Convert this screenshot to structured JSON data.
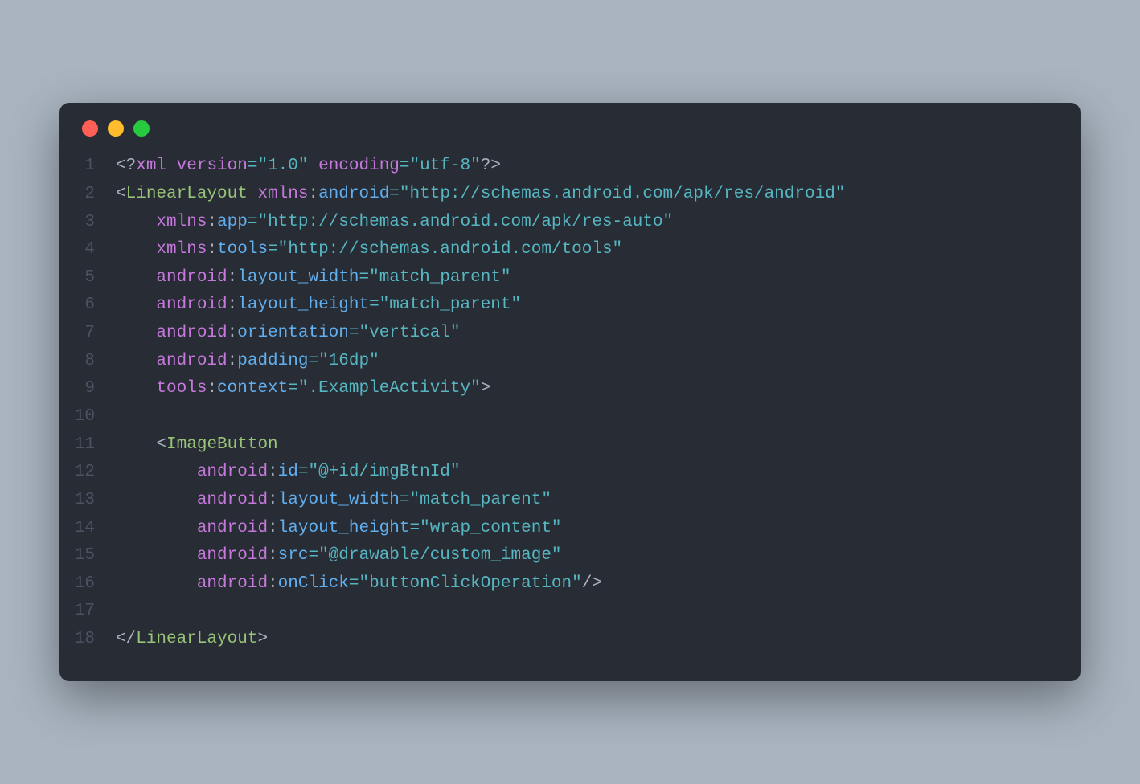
{
  "window": {
    "traffic": {
      "red": "#ff5f56",
      "yellow": "#ffbd2e",
      "green": "#27c93f"
    }
  },
  "lines": {
    "n1": "1",
    "n2": "2",
    "n3": "3",
    "n4": "4",
    "n5": "5",
    "n6": "6",
    "n7": "7",
    "n8": "8",
    "n9": "9",
    "n10": "10",
    "n11": "11",
    "n12": "12",
    "n13": "13",
    "n14": "14",
    "n15": "15",
    "n16": "16",
    "n17": "17",
    "n18": "18"
  },
  "t": {
    "lt": "<",
    "gt": ">",
    "ltq": "<?",
    "qgt": "?>",
    "slgt": "/>",
    "ltsl": "</",
    "eq": "=",
    "xml": "xml",
    "version": "version",
    "encoding": "encoding",
    "LinearLayout": "LinearLayout",
    "ImageButton": "ImageButton",
    "xmlns": "xmlns",
    "android": "android",
    "app": "app",
    "tools": "tools",
    "layout_width": "layout_width",
    "layout_height": "layout_height",
    "orientation": "orientation",
    "padding": "padding",
    "context": "context",
    "id": "id",
    "src": "src",
    "onClick": "onClick",
    "v1_0": "\"1.0\"",
    "utf8": "\"utf-8\"",
    "ns_android": "\"http://schemas.android.com/apk/res/android\"",
    "ns_app": "\"http://schemas.android.com/apk/res-auto\"",
    "ns_tools": "\"http://schemas.android.com/tools\"",
    "match_parent": "\"match_parent\"",
    "wrap_content": "\"wrap_content\"",
    "vertical": "\"vertical\"",
    "d16dp": "\"16dp\"",
    "exact": "\".ExampleActivity\"",
    "imgid": "\"@+id/imgBtnId\"",
    "customimg": "\"@drawable/custom_image\"",
    "btnclick": "\"buttonClickOperation\"",
    "sp": " ",
    "ind1": "    ",
    "ind2": "        "
  }
}
